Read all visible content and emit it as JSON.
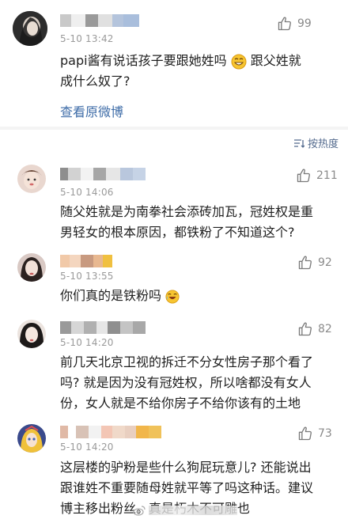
{
  "post": {
    "time": "5-10 13:42",
    "likes": "99",
    "text_line1": "papi酱有说话孩子要跟她姓吗",
    "text_line1b": "跟父姓就",
    "text_line2": "成什么奴了?",
    "view_original": "查看原微博"
  },
  "sort": {
    "label": "按热度"
  },
  "comments": [
    {
      "time": "5-10 14:06",
      "likes": "211",
      "lines": [
        "随父姓就是为南拳社会添砖加瓦，冠姓权是重",
        "男轻女的根本原因，都铁粉了不知道这个?"
      ]
    },
    {
      "time": "5-10 13:55",
      "likes": "92",
      "lines": [
        "你们真的是铁粉吗"
      ]
    },
    {
      "time": "5-10 14:20",
      "likes": "82",
      "lines": [
        "前几天北京卫视的拆迁不分女性房子那个看了",
        "吗? 就是因为没有冠姓权，所以啥都没有女人",
        "份，女人就是不给你房子不给你该有的土地"
      ]
    },
    {
      "time": "5-10 14:20",
      "likes": "73",
      "lines": [
        "这层楼的驴粉是些什么狗屁玩意儿? 还能说出",
        "跟谁姓不重要随母姓就平等了吗这种话。建议",
        "博主移出粉丝。真是朽木不可雕也"
      ]
    }
  ],
  "colors": {
    "link": "#3f6da8",
    "meta": "#9a9a9a",
    "divider": "#f4f4f4"
  }
}
